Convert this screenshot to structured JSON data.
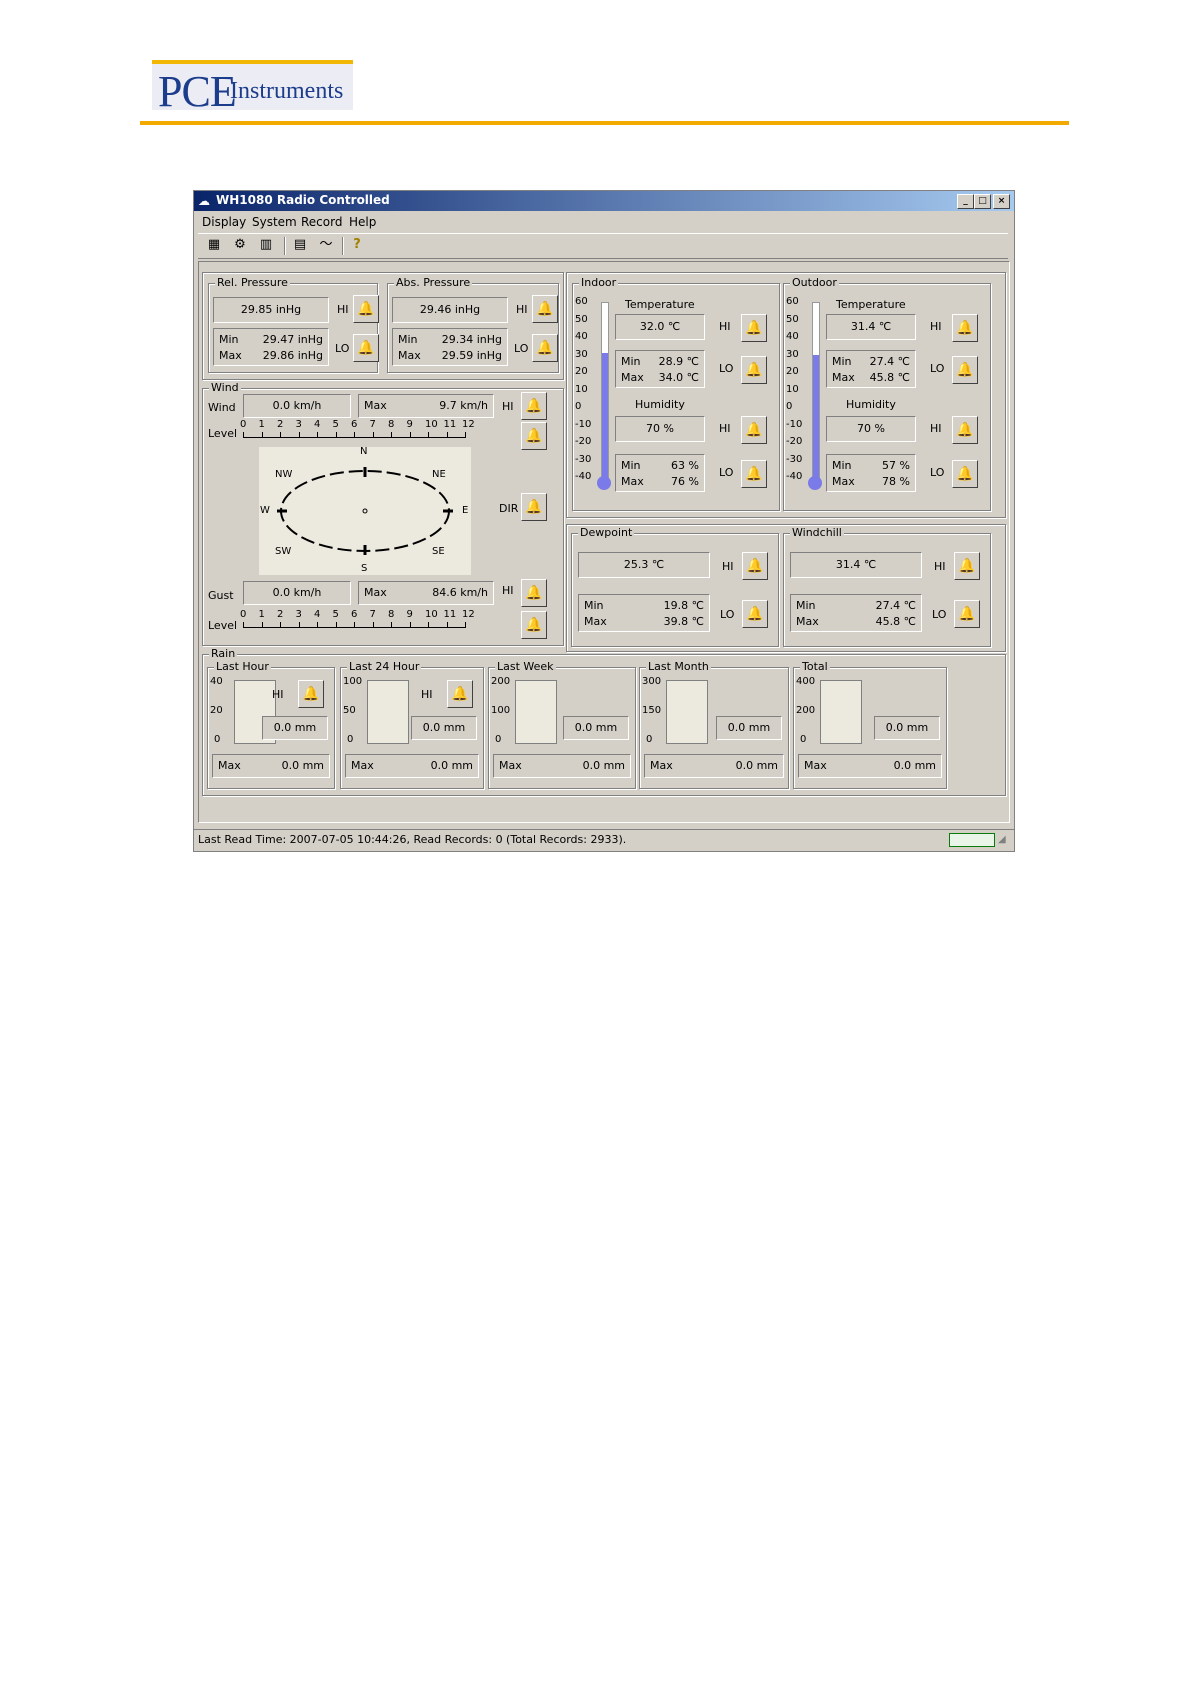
{
  "logo": {
    "pce": "PCE",
    "instruments": "Instruments"
  },
  "window": {
    "title": "WH1080 Radio Controlled",
    "menu": [
      "Display",
      "System",
      "Record",
      "Help"
    ],
    "status": "Last Read Time: 2007-07-05 10:44:26, Read Records: 0 (Total Records: 2933)."
  },
  "labels": {
    "hi": "HI",
    "lo": "LO",
    "min": "Min",
    "max": "Max",
    "dir": "DIR"
  },
  "pressure": {
    "rel": {
      "title": "Rel. Pressure",
      "value": "29.85 inHg",
      "min": "29.47 inHg",
      "max": "29.86 inHg"
    },
    "abs": {
      "title": "Abs. Pressure",
      "value": "29.46 inHg",
      "min": "29.34 inHg",
      "max": "29.59 inHg"
    }
  },
  "wind": {
    "title": "Wind",
    "wind_label": "Wind",
    "wind_value": "0.0 km/h",
    "wind_max": "9.7 km/h",
    "level_label": "Level",
    "gust_label": "Gust",
    "gust_value": "0.0 km/h",
    "gust_max": "84.6 km/h",
    "scale": [
      "0",
      "1",
      "2",
      "3",
      "4",
      "5",
      "6",
      "7",
      "8",
      "9",
      "10",
      "11",
      "12"
    ],
    "compass": {
      "n": "N",
      "ne": "NE",
      "e": "E",
      "se": "SE",
      "s": "S",
      "sw": "SW",
      "w": "W",
      "nw": "NW"
    }
  },
  "thermo_scale": [
    "60",
    "50",
    "40",
    "30",
    "20",
    "10",
    "0",
    "-10",
    "-20",
    "-30",
    "-40"
  ],
  "indoor": {
    "title": "Indoor",
    "temp_label": "Temperature",
    "temp": "32.0 ℃",
    "temp_min": "28.9 ℃",
    "temp_max": "34.0 ℃",
    "hum_label": "Humidity",
    "hum": "70 %",
    "hum_min": "63 %",
    "hum_max": "76 %",
    "fill_fraction": 0.72
  },
  "outdoor": {
    "title": "Outdoor",
    "temp_label": "Temperature",
    "temp": "31.4 ℃",
    "temp_min": "27.4 ℃",
    "temp_max": "45.8 ℃",
    "hum_label": "Humidity",
    "hum": "70 %",
    "hum_min": "57 %",
    "hum_max": "78 %",
    "fill_fraction": 0.71
  },
  "dewpoint": {
    "title": "Dewpoint",
    "value": "25.3 ℃",
    "min": "19.8 ℃",
    "max": "39.8 ℃"
  },
  "windchill": {
    "title": "Windchill",
    "value": "31.4 ℃",
    "min": "27.4 ℃",
    "max": "45.8 ℃"
  },
  "rain": {
    "title": "Rain",
    "panels": [
      {
        "title": "Last Hour",
        "scale": [
          "40",
          "20",
          "0"
        ],
        "value": "0.0 mm",
        "max": "0.0 mm"
      },
      {
        "title": "Last 24 Hour",
        "scale": [
          "100",
          "50",
          "0"
        ],
        "value": "0.0 mm",
        "max": "0.0 mm"
      },
      {
        "title": "Last Week",
        "scale": [
          "200",
          "100",
          "0"
        ],
        "value": "0.0 mm",
        "max": "0.0 mm"
      },
      {
        "title": "Last Month",
        "scale": [
          "300",
          "150",
          "0"
        ],
        "value": "0.0 mm",
        "max": "0.0 mm"
      },
      {
        "title": "Total",
        "scale": [
          "400",
          "200",
          "0"
        ],
        "value": "0.0 mm",
        "max": "0.0 mm"
      }
    ]
  },
  "icons": [
    "app-icon",
    "minimize-icon",
    "maximize-icon",
    "close-icon",
    "display-tool-icon",
    "setup-tool-icon",
    "history-tool-icon",
    "calendar-tool-icon",
    "graph-tool-icon",
    "help-tool-icon",
    "bell-icon",
    "resize-grip-icon"
  ]
}
